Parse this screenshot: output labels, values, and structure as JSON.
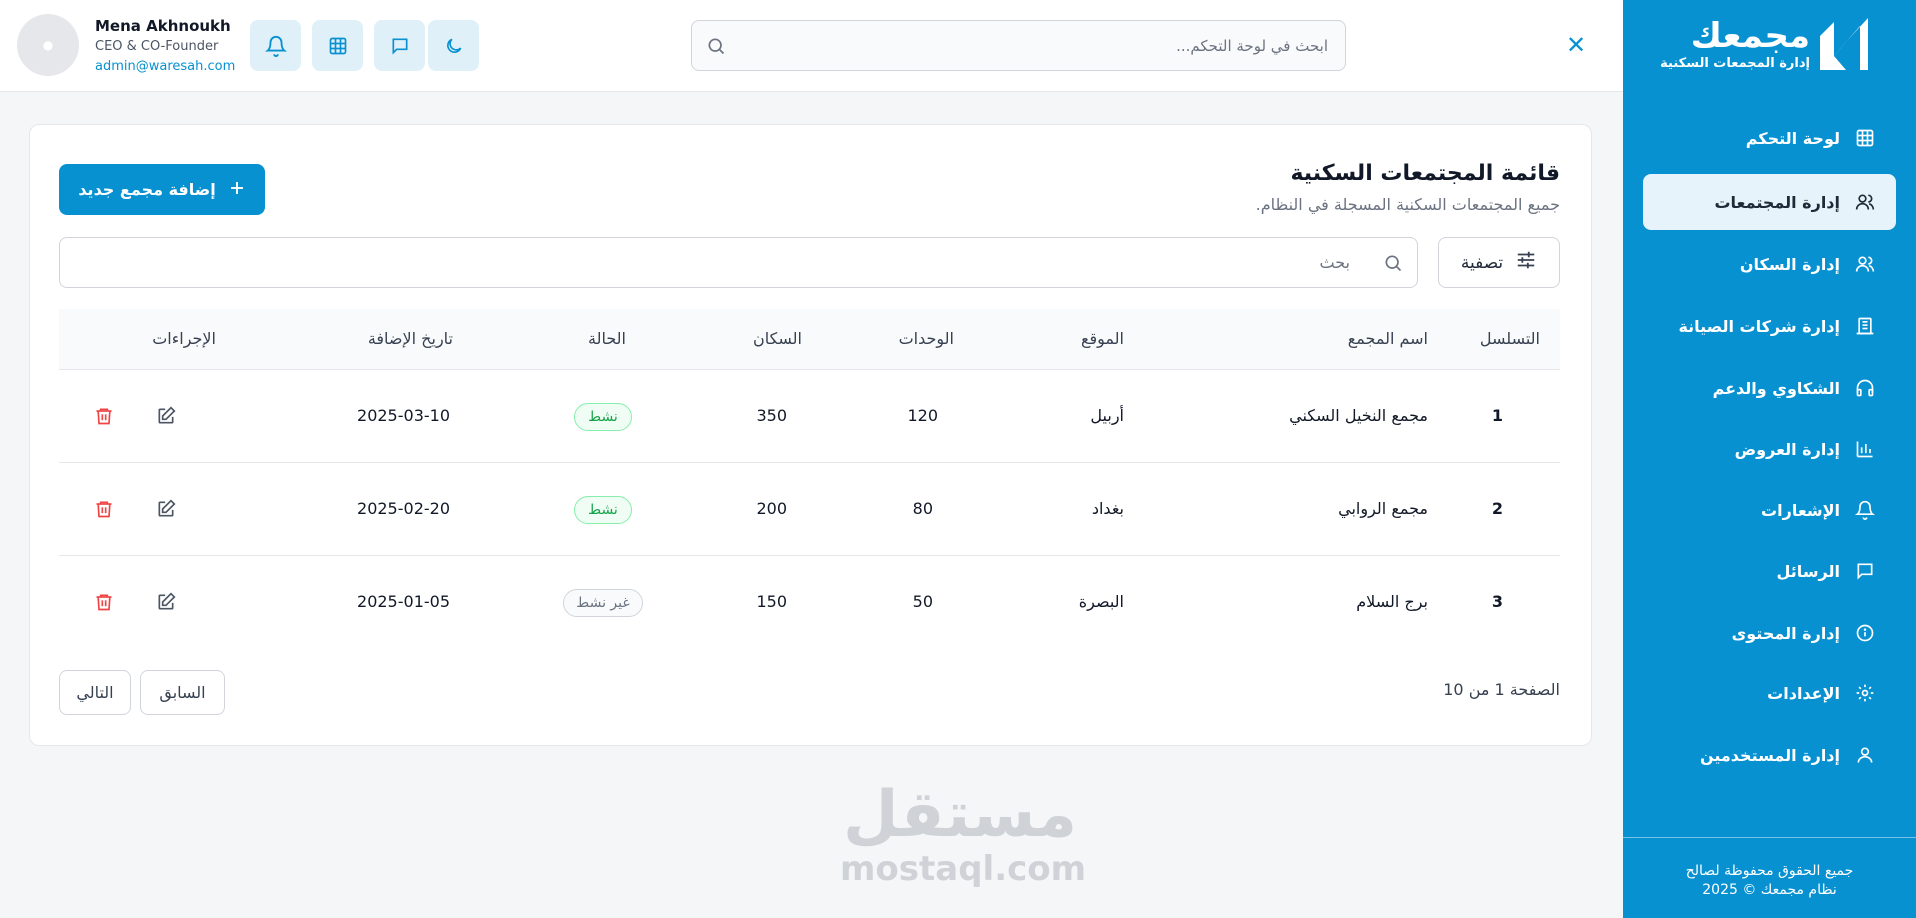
{
  "sidebar": {
    "logo_title": "مجمعك",
    "logo_subtitle": "إدارة المجمعات السكنية",
    "items": [
      {
        "label": "لوحة التحكم",
        "icon": "dashboard-grid-icon"
      },
      {
        "label": "إدارة المجتمعات",
        "icon": "users-icon",
        "active": true
      },
      {
        "label": "إدارة السكان",
        "icon": "residents-icon"
      },
      {
        "label": "إدارة شركات الصيانة",
        "icon": "building-icon"
      },
      {
        "label": "الشكاوي والدعم",
        "icon": "headphones-icon"
      },
      {
        "label": "إدارة العروض",
        "icon": "chart-bars-icon"
      },
      {
        "label": "الإشعارات",
        "icon": "bell-icon"
      },
      {
        "label": "الرسائل",
        "icon": "message-icon"
      },
      {
        "label": "إدارة المحتوى",
        "icon": "info-icon"
      },
      {
        "label": "الإعدادات",
        "icon": "gear-icon"
      },
      {
        "label": "إدارة المستخدمين",
        "icon": "user-icon"
      }
    ],
    "copyright_line1": "جميع الحقوق محفوظة لصالح",
    "copyright_line2": "نظام مجمعك © 2025"
  },
  "header": {
    "search_placeholder": "ابحث في لوحة التحكم...",
    "user": {
      "name": "Mena Akhnoukh",
      "role": "CEO & CO-Founder",
      "email": "admin@waresah.com"
    }
  },
  "main": {
    "title": "قائمة المجتمعات السكنية",
    "subtitle": "جميع المجتمعات السكنية المسجلة في النظام.",
    "add_button": "إضافة مجمع جديد",
    "filter_button": "تصفية",
    "search_placeholder": "بحث",
    "columns": [
      "التسلسل",
      "اسم المجمع",
      "الموقع",
      "الوحدات",
      "السكان",
      "الحالة",
      "تاريخ الإضافة",
      "الإجراءات"
    ],
    "rows": [
      {
        "id": "1",
        "name": "مجمع النخيل السكني",
        "location": "أربيل",
        "units": "120",
        "residents": "350",
        "status": "نشط",
        "status_type": "active",
        "date": "2025-03-10"
      },
      {
        "id": "2",
        "name": "مجمع الروابي",
        "location": "بغداد",
        "units": "80",
        "residents": "200",
        "status": "نشط",
        "status_type": "active",
        "date": "2025-02-20"
      },
      {
        "id": "3",
        "name": "برج السلام",
        "location": "البصرة",
        "units": "50",
        "residents": "150",
        "status": "غير نشط",
        "status_type": "inactive",
        "date": "2025-01-05"
      }
    ],
    "pagination": {
      "info": "الصفحة 1 من 10",
      "prev": "السابق",
      "next": "التالي"
    }
  },
  "watermark": {
    "arabic": "مستقل",
    "latin": "mostaql.com"
  },
  "colors": {
    "primary": "#0891d1",
    "active_status": "#16a34a",
    "danger": "#ef4444"
  }
}
